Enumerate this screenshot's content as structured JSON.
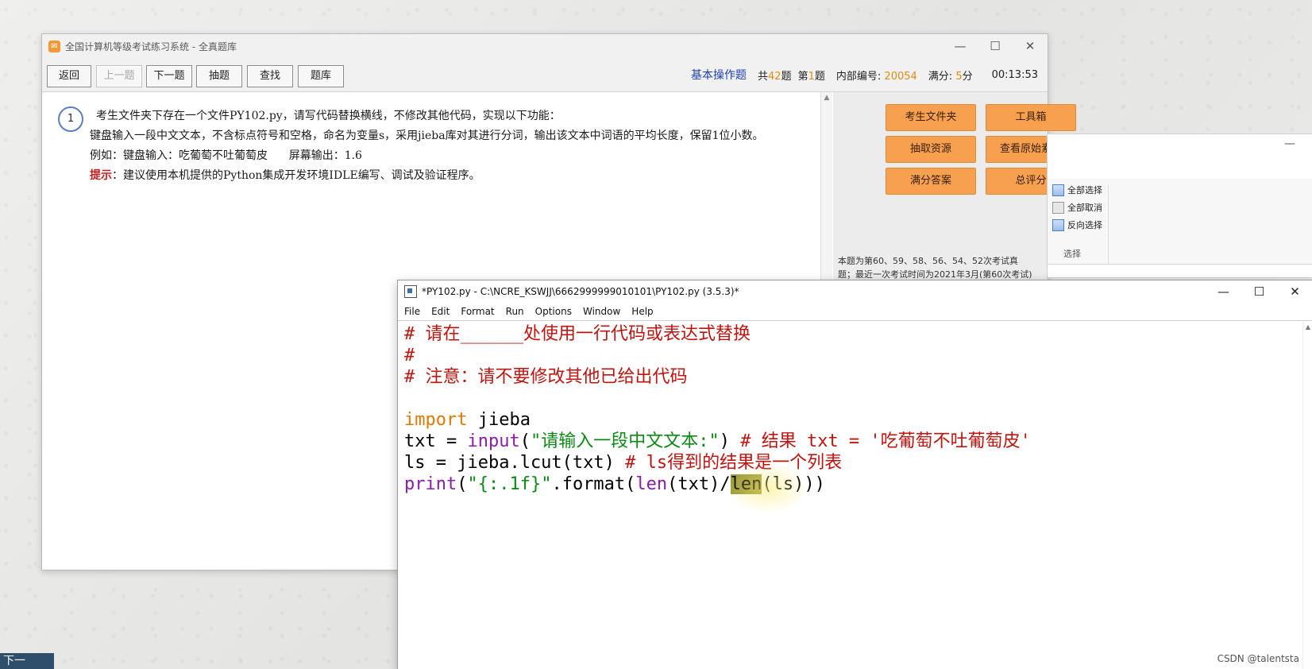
{
  "exam": {
    "logo_glyph": "✉",
    "title": "全国计算机等级考试练习系统 - 全真题库",
    "controls": {
      "minimize": "—",
      "maximize": "☐",
      "close": "✕"
    },
    "toolbar": {
      "back": "返回",
      "prev": "上一题",
      "next": "下一题",
      "draw": "抽题",
      "find": "查找",
      "bank": "题库"
    },
    "status": {
      "category": "基本操作题",
      "total_prefix": "共",
      "total_value": "42",
      "total_suffix": "题",
      "current_prefix": "第",
      "current_value": "1",
      "current_suffix": "题",
      "id_label": "内部编号:",
      "id_value": "20054",
      "score_label": "满分:",
      "score_value": "5",
      "score_suffix": "分",
      "timer": "00:13:53"
    },
    "question": {
      "number": "1",
      "line1": "考生文件夹下存在一个文件PY102.py，请写代码替换横线，不修改其他代码，实现以下功能：",
      "line2": "键盘输入一段中文文本，不含标点符号和空格，命名为变量s，采用jieba库对其进行分词，输出该文本中词语的平均长度，保留1位小数。",
      "line3": "例如：键盘输入：吃葡萄不吐葡萄皮      屏幕输出：1.6",
      "hint_label": "提示",
      "hint_text": "：建议使用本机提供的Python集成开发环境IDLE编写、调试及验证程序。"
    },
    "side_buttons": {
      "exam_folder": "考生文件夹",
      "toolbox": "工具箱",
      "extract": "抽取资源",
      "view_original": "查看原始素材",
      "full_answer": "满分答案",
      "total_score": "总评分"
    },
    "side_note": "本题为第60、59、58、56、54、52次考试真题；最近一次考试时间为2021年3月(第60次考试)"
  },
  "explorer": {
    "minimize": "—",
    "select_all": "全部选择",
    "select_none": "全部取消",
    "invert": "反向选择",
    "section": "选择"
  },
  "idle": {
    "title": "*PY102.py - C:\\NCRE_KSWJJ\\6662999999010101\\PY102.py (3.5.3)*",
    "controls": {
      "minimize": "—",
      "maximize": "☐",
      "close": "✕"
    },
    "menu": [
      "File",
      "Edit",
      "Format",
      "Run",
      "Options",
      "Window",
      "Help"
    ],
    "code": {
      "l1": "# 请在______处使用一行代码或表达式替换",
      "l2": "#",
      "l3": "# 注意：请不要修改其他已给出代码",
      "l4": "",
      "l5_kw": "import",
      "l5_rest": " jieba",
      "l6_a": "txt = ",
      "l6_builtin": "input",
      "l6_b": "(",
      "l6_str": "\"请输入一段中文文本:\"",
      "l6_c": ") ",
      "l6_comment": "# 结果 txt = '吃葡萄不吐葡萄皮'",
      "l7_a": "ls = jieba.lcut(txt) ",
      "l7_comment": "# ls得到的结果是一个列表",
      "l8_builtin1": "print",
      "l8_a": "(",
      "l8_str": "\"{:.1f}\"",
      "l8_b": ".format(",
      "l8_builtin2": "len",
      "l8_c": "(txt)/",
      "l8_sel": "len",
      "l8_d": "(ls)))"
    }
  },
  "bottom_tab": "下一",
  "watermark": "CSDN @talentsta",
  "colors": {
    "accent_orange": "#f7a150",
    "category_blue": "#1f3fb5",
    "comment_red": "#c0140f",
    "keyword_orange": "#e07900",
    "builtin_purple": "#8a1cae",
    "string_green": "#0b8a14"
  }
}
